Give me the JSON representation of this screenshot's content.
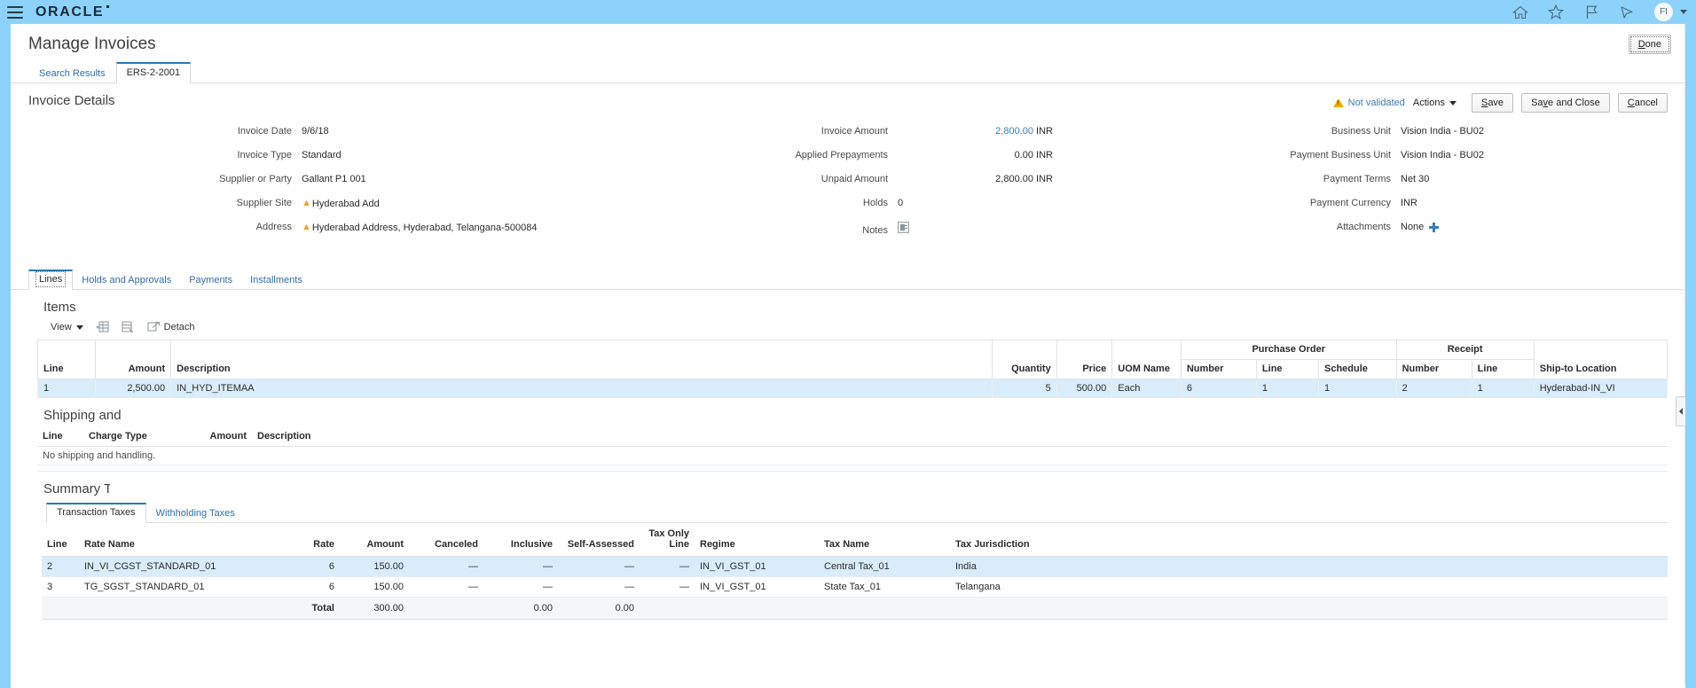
{
  "global_header": {
    "brand": "ORACLE",
    "icons": [
      "home-icon",
      "favorites-star-icon",
      "flag-icon",
      "notifications-bell-icon"
    ],
    "avatar_initials": "FI"
  },
  "page": {
    "title": "Manage Invoices",
    "done_label": "Done"
  },
  "top_tabs": [
    {
      "label": "Search Results",
      "active": false
    },
    {
      "label": "ERS-2-2001",
      "active": true
    }
  ],
  "invoice_details": {
    "heading": "Invoice Details",
    "status": {
      "icon": "warning-triangle-icon",
      "label": "Not validated"
    },
    "actions_label": "Actions",
    "buttons": {
      "save": "Save",
      "save_and_close": "Save and Close",
      "cancel": "Cancel"
    },
    "column1": [
      {
        "label": "Invoice Date",
        "value": "9/6/18",
        "required": false
      },
      {
        "label": "Invoice Type",
        "value": "Standard",
        "required": false
      },
      {
        "label": "Supplier or Party",
        "value": "Gallant P1 001",
        "required": false
      },
      {
        "label": "Supplier Site",
        "value": "Hyderabad Add",
        "required": true
      },
      {
        "label": "Address",
        "value": "Hyderabad Address, Hyderabad, Telangana-500084",
        "required": true
      }
    ],
    "column2": [
      {
        "label": "Invoice Amount",
        "value": "2,800.00",
        "currency": "INR",
        "link": true
      },
      {
        "label": "Applied Prepayments",
        "value": "0.00",
        "currency": "INR",
        "link": false
      },
      {
        "label": "Unpaid Amount",
        "value": "2,800.00",
        "currency": "INR",
        "link": false
      },
      {
        "label": "Holds",
        "value": "0",
        "currency": "",
        "link": false
      },
      {
        "label": "Notes",
        "value": "",
        "currency": "",
        "link": false,
        "icon": "notes-icon"
      }
    ],
    "column3": [
      {
        "label": "Business Unit",
        "value": "Vision India - BU02"
      },
      {
        "label": "Payment Business Unit",
        "value": "Vision India - BU02"
      },
      {
        "label": "Payment Terms",
        "value": "Net 30"
      },
      {
        "label": "Payment Currency",
        "value": "INR"
      },
      {
        "label": "Attachments",
        "value": "None",
        "icon": "add-plus-icon"
      }
    ]
  },
  "lower_tabs": [
    {
      "label": "Lines",
      "active": true
    },
    {
      "label": "Holds and Approvals",
      "active": false
    },
    {
      "label": "Payments",
      "active": false
    },
    {
      "label": "Installments",
      "active": false
    }
  ],
  "items_section": {
    "heading": "Items",
    "toolbar": {
      "view_label": "View",
      "detach_label": "Detach",
      "icons": [
        "insert-row-icon",
        "delete-row-icon",
        "detach-icon"
      ]
    },
    "group_headers": {
      "purchase_order": "Purchase Order",
      "receipt": "Receipt"
    },
    "columns": [
      "Line",
      "Amount",
      "Description",
      "Quantity",
      "Price",
      "UOM Name",
      "Number",
      "Line",
      "Schedule",
      "Number",
      "Line",
      "Ship-to Location"
    ],
    "rows": [
      {
        "line": "1",
        "amount": "2,500.00",
        "description": "IN_HYD_ITEMAA",
        "quantity": "5",
        "price": "500.00",
        "uom_name": "Each",
        "po_number": "6",
        "po_line": "1",
        "po_schedule": "1",
        "receipt_number": "2",
        "receipt_line": "1",
        "ship_to_location": "Hyderabad-IN_VI",
        "selected": true
      }
    ]
  },
  "shipping_section": {
    "heading": "Shipping and Handling",
    "columns": [
      "Line",
      "Charge Type",
      "Amount",
      "Description"
    ],
    "empty_message": "No shipping and handling."
  },
  "tax_section": {
    "heading": "Summary Tax Lines",
    "tabs": [
      {
        "label": "Transaction Taxes",
        "active": true
      },
      {
        "label": "Withholding Taxes",
        "active": false
      }
    ],
    "columns": [
      "Line",
      "Rate Name",
      "Rate",
      "Amount",
      "Canceled",
      "Inclusive",
      "Self-Assessed",
      "Tax Only Line",
      "Regime",
      "Tax Name",
      "Tax Jurisdiction"
    ],
    "rows": [
      {
        "line": "2",
        "rate_name": "IN_VI_CGST_STANDARD_01",
        "rate": "6",
        "amount": "150.00",
        "canceled": "—",
        "inclusive": "—",
        "self_assessed": "—",
        "tax_only_line": "—",
        "regime": "IN_VI_GST_01",
        "tax_name": "Central Tax_01",
        "tax_jurisdiction": "India",
        "selected": true
      },
      {
        "line": "3",
        "rate_name": "TG_SGST_STANDARD_01",
        "rate": "6",
        "amount": "150.00",
        "canceled": "—",
        "inclusive": "—",
        "self_assessed": "—",
        "tax_only_line": "—",
        "regime": "IN_VI_GST_01",
        "tax_name": "State Tax_01",
        "tax_jurisdiction": "Telangana",
        "selected": false
      }
    ],
    "totals": {
      "label": "Total",
      "amount": "300.00",
      "inclusive": "0.00",
      "self_assessed": "0.00"
    }
  },
  "colors": {
    "brand_header": "#8dd2fa",
    "link": "#3b7cb5",
    "row_selected": "#d9ecf9",
    "tab_active_underline": "#2a7ab0",
    "warning": "#f0ab00",
    "required_marker": "#e8a33d"
  }
}
